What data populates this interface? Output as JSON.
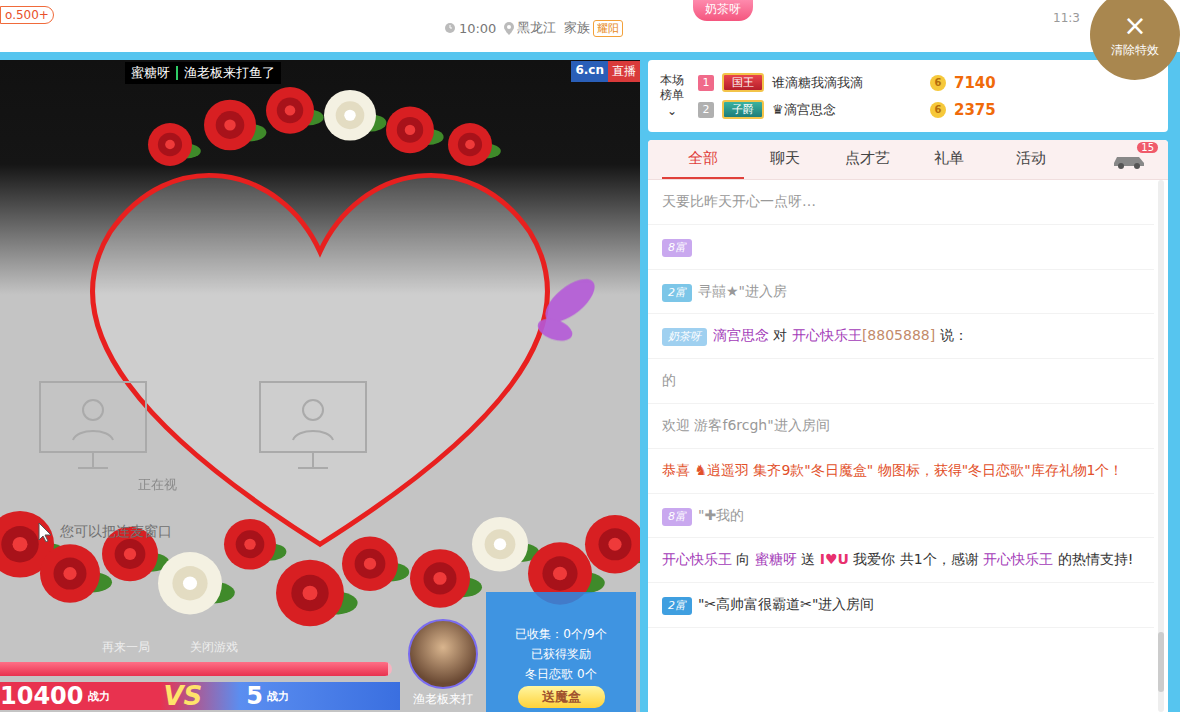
{
  "header": {
    "level_badge": "o.500+",
    "time": "10:00",
    "location": "黑龙江",
    "family_label": "家族",
    "family_badge": "耀阳",
    "host_badge": "奶茶呀",
    "clock": "11:3",
    "clear_effects": {
      "icon": "×",
      "label": "清除特效"
    }
  },
  "video": {
    "host": "蜜糖呀",
    "title": "渔老板来打鱼了",
    "logo": "6.cn",
    "logo_tag": "直播",
    "placeholder_status": "正在视",
    "placeholder_hint": "您可以把连麦窗口"
  },
  "pk": {
    "actions": [
      "再来一局",
      "关闭游戏"
    ],
    "level": 0.99,
    "left_score": "10400",
    "left_unit": "战力",
    "vs": "VS",
    "right_score": "5",
    "right_unit": "战力",
    "opponent": "渔老板来打"
  },
  "reward": {
    "collected": "已收集：0个/9个",
    "status": "已获得奖励",
    "item": "冬日恋歌 0个",
    "button": "送魔盒"
  },
  "ranking": {
    "label_top": "本场",
    "label_bottom": "榜单",
    "expand_icon": "⌄",
    "rows": [
      {
        "rank": "1",
        "color": "#f06a8a",
        "title": "国王",
        "name": "谁滴糖我滴我滴",
        "score": "7140",
        "coin": "6"
      },
      {
        "rank": "2",
        "color": "#b0b0b0",
        "title": "子爵",
        "name": "♛滴宫思念",
        "score": "2375",
        "coin": "6"
      }
    ]
  },
  "tabs": [
    {
      "label": "全部",
      "selected": true
    },
    {
      "label": "聊天",
      "selected": false
    },
    {
      "label": "点才艺",
      "selected": false
    },
    {
      "label": "礼单",
      "selected": false
    },
    {
      "label": "活动",
      "selected": false
    }
  ],
  "car_badge": "15",
  "chat": [
    {
      "badge": "",
      "badge_color": "#ffffff",
      "parts": [
        {
          "text": "天要比昨天开心一点呀…",
          "tone": "gray"
        }
      ]
    },
    {
      "badge": "8富",
      "badge_color": "#c9a8ef",
      "parts": []
    },
    {
      "badge": "2富",
      "badge_color": "#7cc6e8",
      "parts": [
        {
          "text": "寻囍★\"进入房",
          "tone": "gray"
        }
      ]
    },
    {
      "badge": "奶茶呀",
      "badge_color": "#9fd0f0",
      "parts": [
        {
          "text": "滴宫思念",
          "tone": "name"
        },
        {
          "text": " 对 ",
          "tone": "dark"
        },
        {
          "text": "开心快乐王",
          "tone": "name"
        },
        {
          "text": "[8805888]",
          "tone": "id"
        },
        {
          "text": " 说：",
          "tone": "dark"
        }
      ]
    },
    {
      "badge": "",
      "badge_color": "#ffffff",
      "parts": [
        {
          "text": "的",
          "tone": "gray"
        }
      ]
    },
    {
      "badge": "",
      "badge_color": "#ffffff",
      "parts": [
        {
          "text": "欢迎 游客f6rcgh\"进入房间",
          "tone": "gray"
        }
      ]
    },
    {
      "badge": "",
      "badge_color": "#ffffff",
      "parts": [
        {
          "text": "恭喜 ♞逍遥羽 集齐9款\"冬日魔盒\" 物图标，获得\"冬日恋歌\"库存礼物1个！",
          "tone": "red"
        }
      ]
    },
    {
      "badge": "8富",
      "badge_color": "#c9a8ef",
      "parts": [
        {
          "text": "\"✚我的",
          "tone": "gray"
        }
      ]
    },
    {
      "badge": "",
      "badge_color": "#ffffff",
      "parts": [
        {
          "text": "开心快乐王",
          "tone": "name"
        },
        {
          "text": " 向 ",
          "tone": "dark"
        },
        {
          "text": "蜜糖呀",
          "tone": "name"
        },
        {
          "text": " 送 ",
          "tone": "dark"
        },
        {
          "text": "I♥U",
          "tone": "gift"
        },
        {
          "text": " 我爱你 共1个，感谢 ",
          "tone": "dark"
        },
        {
          "text": "开心快乐王",
          "tone": "name"
        },
        {
          "text": " 的热情支持!",
          "tone": "dark"
        }
      ]
    },
    {
      "badge": "2富",
      "badge_color": "#3f9fe0",
      "parts": [
        {
          "text": "\"✂高帅富很霸道✂\"进入房间",
          "tone": "dark"
        }
      ]
    }
  ]
}
